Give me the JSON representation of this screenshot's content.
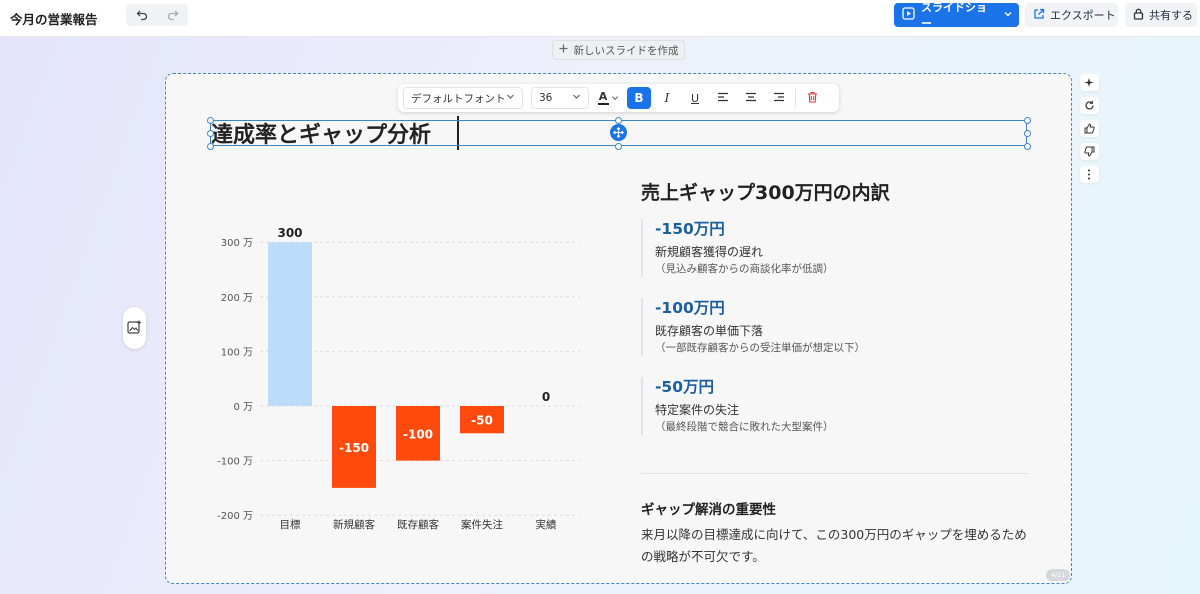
{
  "header": {
    "doc_title": "今月の営業報告",
    "slideshow_label": "スライドショー",
    "export_label": "エクスポート",
    "share_label": "共有する"
  },
  "new_slide_label": "新しいスライドを作成",
  "format_toolbar": {
    "font": "デフォルトフォント",
    "size": "36",
    "color_glyph": "A",
    "bold_glyph": "B",
    "italic_glyph": "I",
    "underline_glyph": "U"
  },
  "slide": {
    "title": "達成率とギャップ分析",
    "page_indicator": "4/11",
    "breakdown": {
      "title": "売上ギャップ300万円の内訳",
      "items": [
        {
          "amount": "-150万円",
          "label": "新規顧客獲得の遅れ",
          "note": "（見込み顧客からの商談化率が低調）"
        },
        {
          "amount": "-100万円",
          "label": "既存顧客の単価下落",
          "note": "（一部既存顧客からの受注単価が想定以下）"
        },
        {
          "amount": "-50万円",
          "label": "特定案件の失注",
          "note": "（最終段階で競合に敗れた大型案件）"
        }
      ]
    },
    "gap": {
      "heading": "ギャップ解消の重要性",
      "body": "来月以降の目標達成に向けて、この300万円のギャップを埋めるための戦略が不可欠です。"
    }
  },
  "colors": {
    "accent": "#1a73e8",
    "bar_positive": "#bcdcfa",
    "bar_negative": "#ff4a0e",
    "amount_text": "#1c5f9e"
  },
  "chart_data": {
    "type": "bar",
    "categories": [
      "目標",
      "新規顧客",
      "既存顧客",
      "案件失注",
      "実績"
    ],
    "values": [
      300,
      -150,
      -100,
      -50,
      0
    ],
    "value_labels": [
      "300",
      "-150",
      "-100",
      "-50",
      "0"
    ],
    "y_ticks": [
      300,
      200,
      100,
      0,
      -100,
      -200
    ],
    "y_tick_labels": [
      "300 万",
      "200 万",
      "100 万",
      "0 万",
      "-100 万",
      "-200 万"
    ],
    "ylim": [
      -200,
      300
    ],
    "grid": true
  }
}
